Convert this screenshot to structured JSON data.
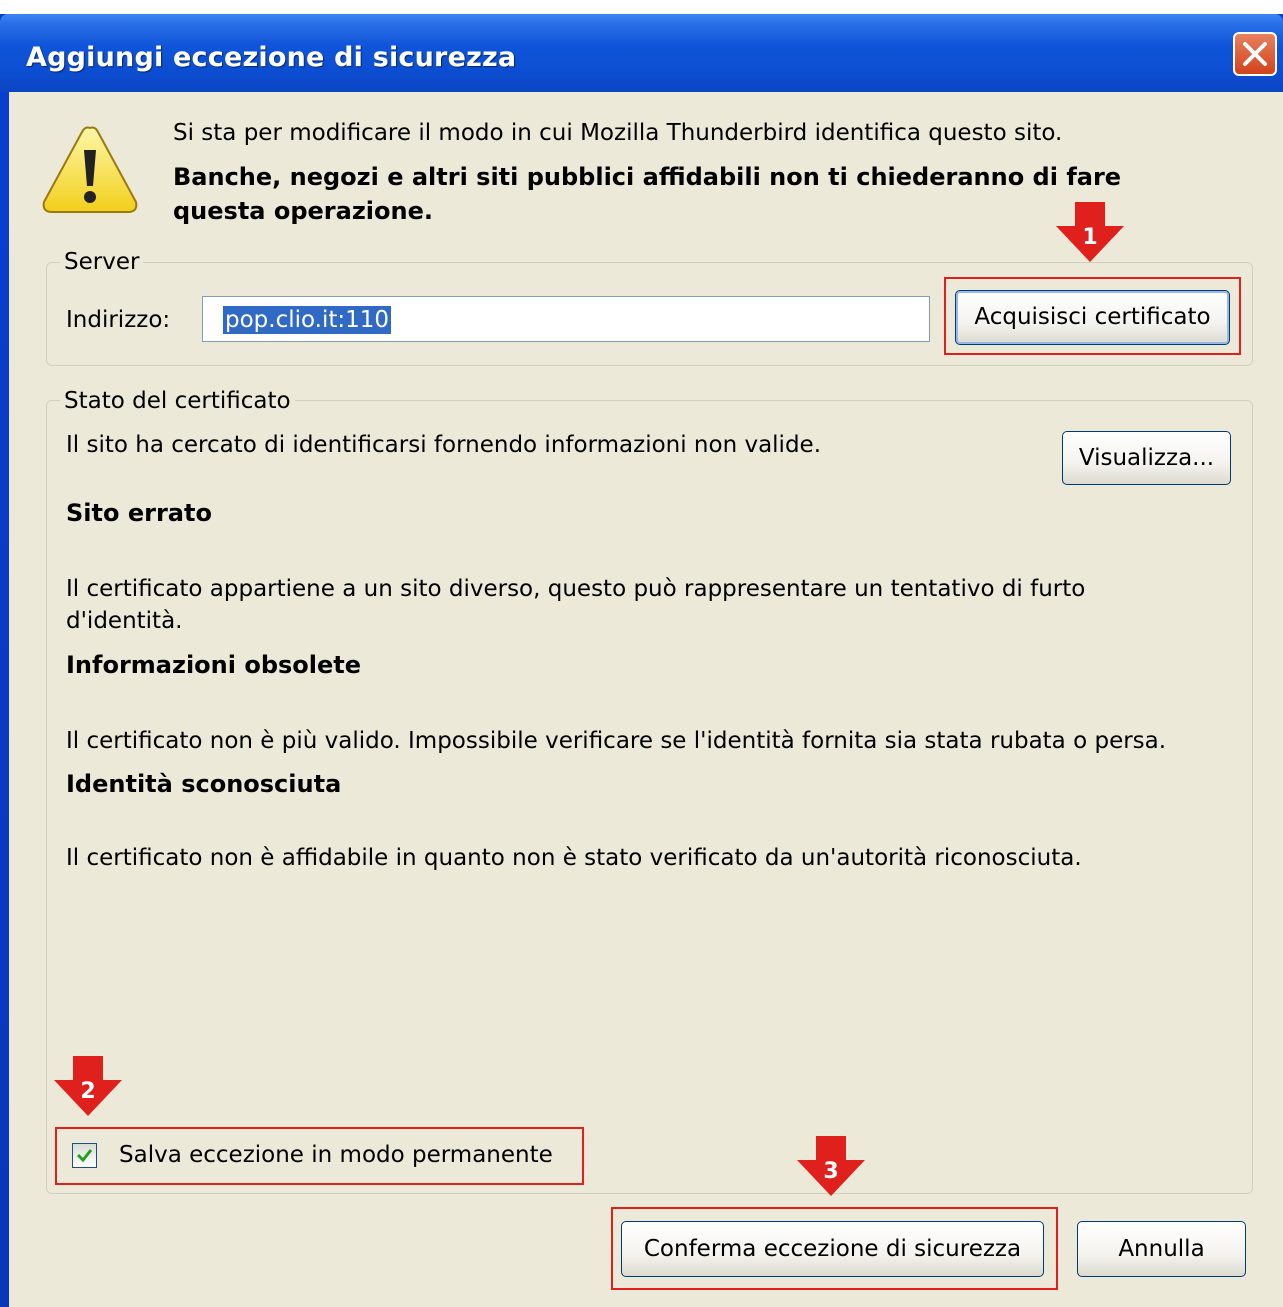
{
  "dialog": {
    "title": "Aggiungi eccezione di sicurezza",
    "intro": "Si sta per modificare il modo in cui Mozilla Thunderbird identifica questo sito.",
    "warning": "Banche, negozi e altri siti pubblici affidabili non ti chiederanno di fare questa operazione."
  },
  "server": {
    "legend": "Server",
    "address_label": "Indirizzo:",
    "address_value": "pop.clio.it:110",
    "get_cert_button": "Acquisisci certificato"
  },
  "cert_status": {
    "legend": "Stato del certificato",
    "summary": "Il sito ha cercato di identificarsi fornendo informazioni non valide.",
    "view_button": "Visualizza...",
    "issues": [
      {
        "title": "Sito errato",
        "description": "Il certificato appartiene a un sito diverso, questo può rappresentare un tentativo di furto d'identità."
      },
      {
        "title": "Informazioni obsolete",
        "description": "Il certificato non è più valido. Impossibile verificare se l'identità fornita sia stata rubata o persa."
      },
      {
        "title": "Identità sconosciuta",
        "description": "Il certificato non è affidabile in quanto non è stato verificato da un'autorità riconosciuta."
      }
    ],
    "permanent_checkbox": {
      "label": "Salva eccezione in modo permanente",
      "checked": true
    }
  },
  "footer": {
    "confirm_button": "Conferma eccezione di sicurezza",
    "cancel_button": "Annulla"
  },
  "annotations": {
    "step1": "1",
    "step2": "2",
    "step3": "3",
    "color": "#e0201c"
  }
}
